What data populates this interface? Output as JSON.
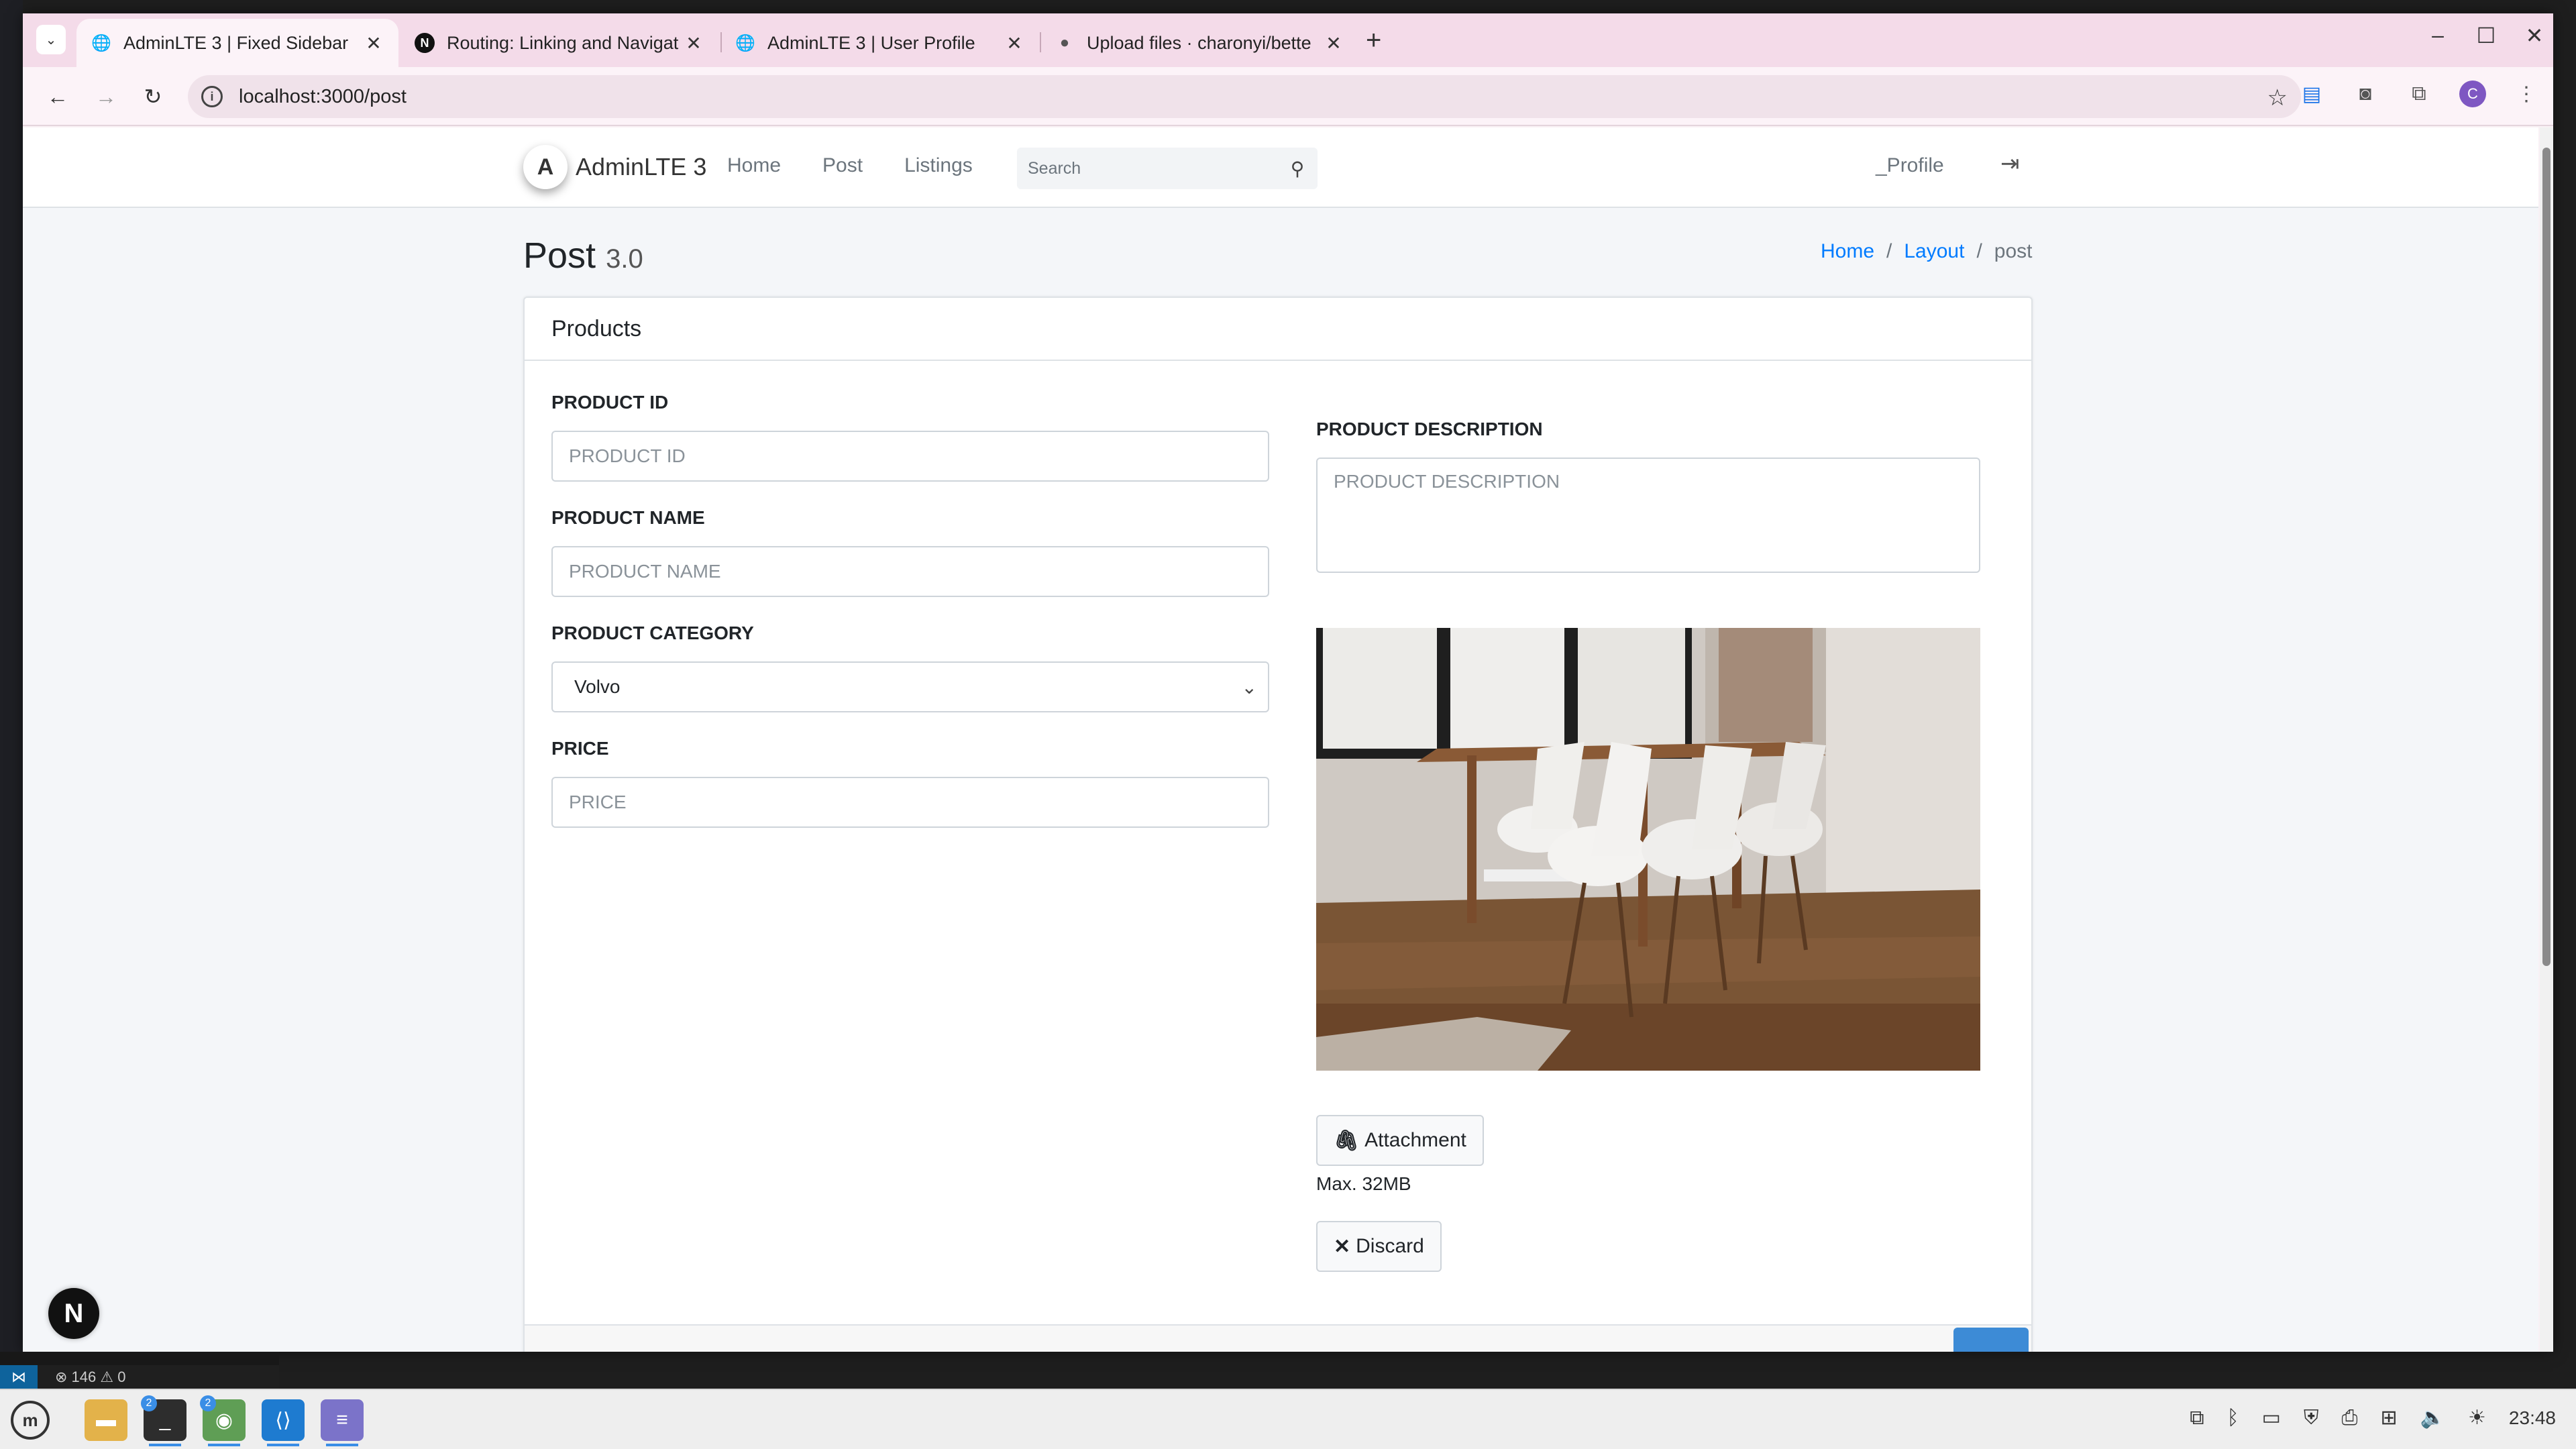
{
  "browser": {
    "tabs": [
      {
        "title": "AdminLTE 3 | Fixed Sidebar",
        "icon": "globe-icon",
        "active": true
      },
      {
        "title": "Routing: Linking and Navigat",
        "icon": "nextjs-icon",
        "active": false
      },
      {
        "title": "AdminLTE 3 | User Profile",
        "icon": "globe-icon",
        "active": false
      },
      {
        "title": "Upload files · charonyi/bette",
        "icon": "github-icon",
        "active": false
      }
    ],
    "url": "localhost:3000/post",
    "profile_initial": "C"
  },
  "navbar": {
    "brand_logo": "A",
    "brand": "AdminLTE 3",
    "links": [
      "Home",
      "Post",
      "Listings"
    ],
    "search_placeholder": "Search",
    "profile": "_Profile"
  },
  "page": {
    "title": "Post",
    "version": "3.0",
    "breadcrumb": {
      "home": "Home",
      "layout": "Layout",
      "current": "post"
    }
  },
  "card": {
    "header": "Products",
    "fields": {
      "product_id": {
        "label": "PRODUCT ID",
        "placeholder": "PRODUCT ID"
      },
      "product_name": {
        "label": "PRODUCT NAME",
        "placeholder": "PRODUCT NAME"
      },
      "product_category": {
        "label": "PRODUCT CATEGORY",
        "value": "Volvo"
      },
      "price": {
        "label": "PRICE",
        "placeholder": "PRICE"
      },
      "product_description": {
        "label": "PRODUCT DESCRIPTION",
        "placeholder": "PRODUCT DESCRIPTION"
      }
    },
    "attachment_label": "Attachment",
    "max_size": "Max. 32MB",
    "discard_label": "Discard"
  },
  "next_badge": "N",
  "vscode": {
    "errors": "146",
    "warnings": "0"
  },
  "taskbar": {
    "terminal_badge": "2",
    "chrome_badge": "2",
    "clock": "23:48"
  },
  "colors": {
    "accent": "#007bff",
    "tabbar": "#f4dbe9",
    "page_bg": "#f4f6f9"
  }
}
